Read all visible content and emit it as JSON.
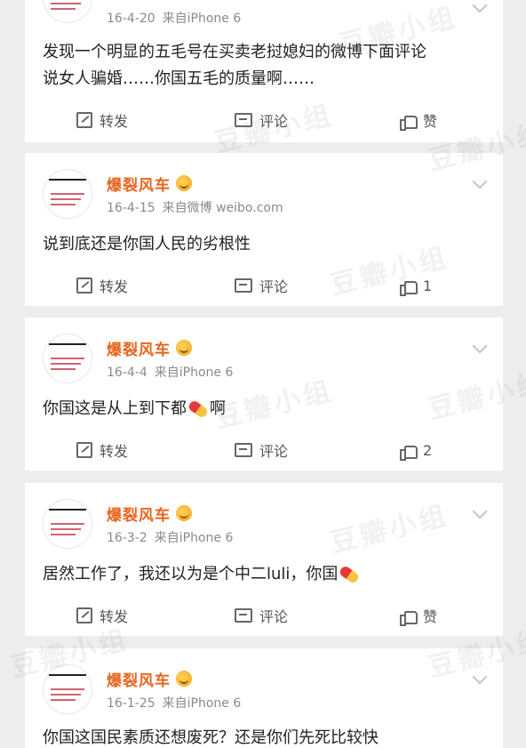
{
  "watermark": "豆瓣小组",
  "colors": {
    "username": "#e8651e",
    "background": "#ededed",
    "card": "#ffffff"
  },
  "posts": [
    {
      "username": "",
      "date": "16-4-20",
      "source": "来自iPhone 6",
      "text_lines": [
        "发现一个明显的五毛号在买卖老挝媳妇的微博下面评论",
        "说女人骗婚……你国五毛的质量啊……"
      ],
      "repost_label": "转发",
      "comment_label": "评论",
      "like_label": "赞"
    },
    {
      "username": "爆裂风车",
      "date": "16-4-15",
      "source": "来自微博 weibo.com",
      "text_lines": [
        "说到底还是你国人民的劣根性"
      ],
      "repost_label": "转发",
      "comment_label": "评论",
      "like_label": "1"
    },
    {
      "username": "爆裂风车",
      "date": "16-4-4",
      "source": "来自iPhone 6",
      "text_before": "你国这是从上到下都",
      "text_after": "啊",
      "emoji": "pill-emoji",
      "repost_label": "转发",
      "comment_label": "评论",
      "like_label": "2"
    },
    {
      "username": "爆裂风车",
      "date": "16-3-2",
      "source": "来自iPhone 6",
      "text_before": "居然工作了，我还以为是个中二luli，你国",
      "text_after": "",
      "emoji": "pill-emoji",
      "repost_label": "转发",
      "comment_label": "评论",
      "like_label": "赞"
    },
    {
      "username": "爆裂风车",
      "date": "16-1-25",
      "source": "来自iPhone 6",
      "text_lines": [
        "你国这国民素质还想废死？还是你们先死比较快"
      ]
    }
  ]
}
